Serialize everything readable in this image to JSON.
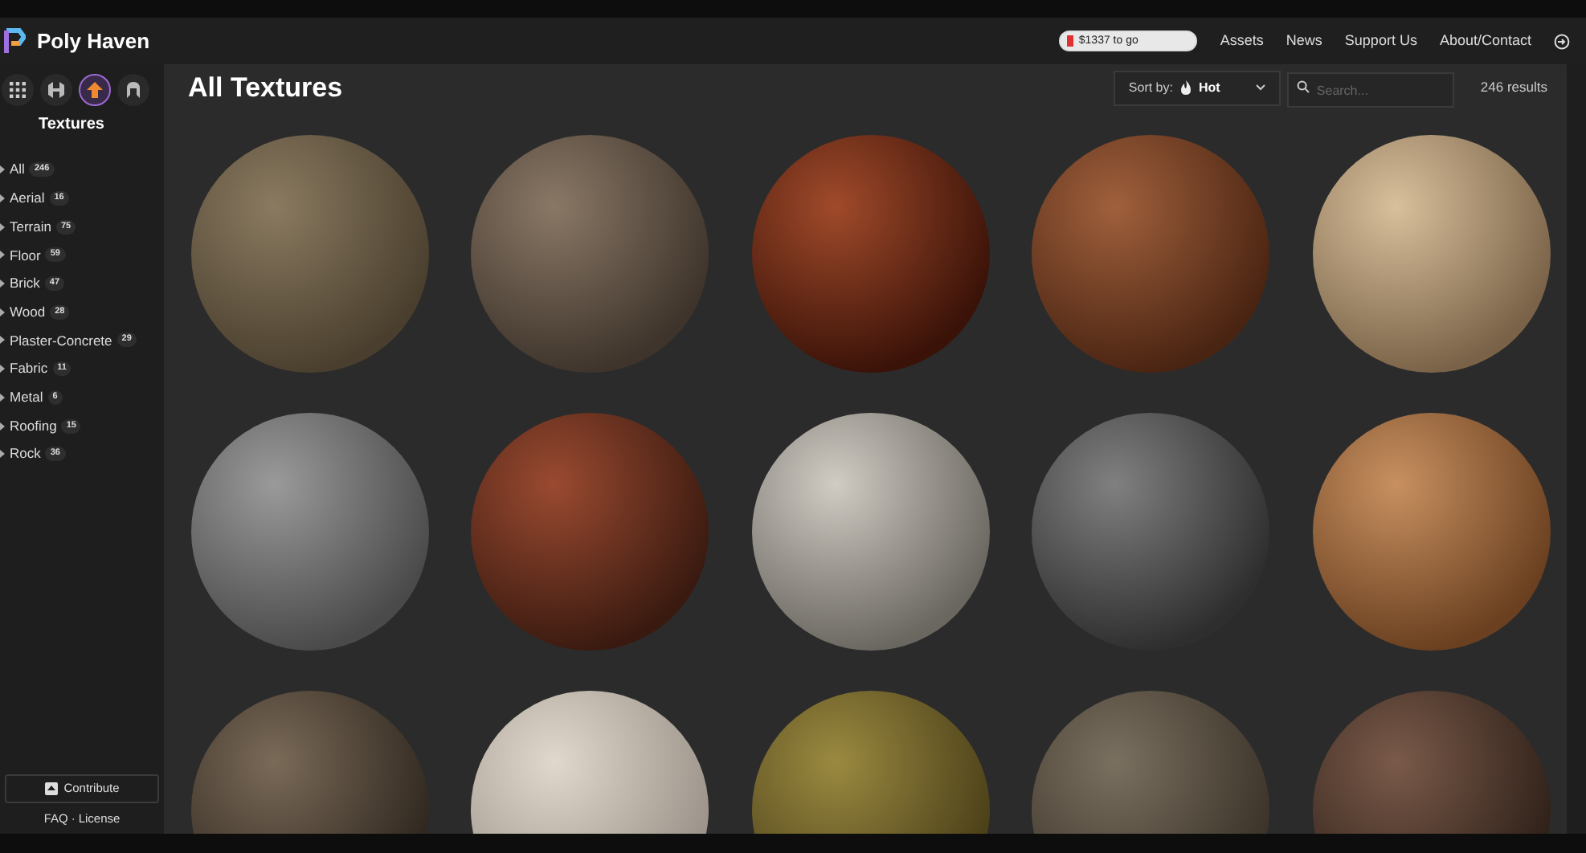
{
  "header": {
    "logo_text": "Poly Haven",
    "donation": {
      "label": "$1337 to go",
      "level": 0.05
    },
    "nav": [
      "Assets",
      "News",
      "Support Us",
      "About/Contact"
    ]
  },
  "sidebar": {
    "asset_types": [
      {
        "kind": "all",
        "selected": false
      },
      {
        "kind": "hdri",
        "selected": false
      },
      {
        "kind": "textures",
        "selected": true
      },
      {
        "kind": "models",
        "selected": false
      }
    ],
    "heading": "Textures",
    "categories": [
      {
        "name": "All",
        "count": "246"
      },
      {
        "name": "Aerial",
        "count": "16"
      },
      {
        "name": "Terrain",
        "count": "75"
      },
      {
        "name": "Floor",
        "count": "59"
      },
      {
        "name": "Brick",
        "count": "47"
      },
      {
        "name": "Wood",
        "count": "28"
      },
      {
        "name": "Plaster-Concrete",
        "count": "29"
      },
      {
        "name": "Fabric",
        "count": "11"
      },
      {
        "name": "Metal",
        "count": "6"
      },
      {
        "name": "Roofing",
        "count": "15"
      },
      {
        "name": "Rock",
        "count": "36"
      }
    ],
    "contribute": "Contribute",
    "footer_links": [
      "FAQ",
      "License"
    ],
    "footer_separator": "·"
  },
  "main": {
    "title": "All Textures",
    "sort": {
      "label": "Sort by:",
      "value": "Hot"
    },
    "search": {
      "placeholder": "Search..."
    },
    "results": "246 results"
  }
}
